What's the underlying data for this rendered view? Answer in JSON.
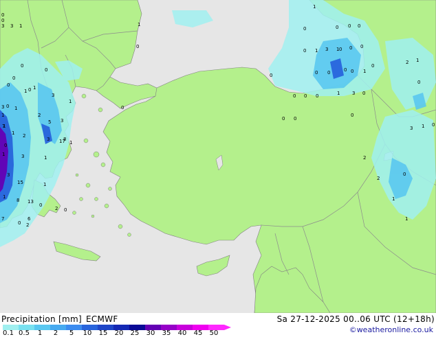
{
  "title": {
    "label": "Precipitation [mm]",
    "model": "ECMWF",
    "datetime": "Sa 27-12-2025 00..06 UTC (12+18h)",
    "credit": "©weatheronline.co.uk"
  },
  "legend": {
    "ticks": [
      "0.1",
      "0.5",
      "1",
      "2",
      "5",
      "10",
      "15",
      "20",
      "25",
      "30",
      "35",
      "40",
      "45",
      "50"
    ],
    "colors": [
      "#a0f0f0",
      "#78e1f0",
      "#5ac8f0",
      "#46aaf0",
      "#3c8cf0",
      "#2864dc",
      "#1e46c8",
      "#1428b4",
      "#0a0a96",
      "#6400b4",
      "#9600c8",
      "#c800dc",
      "#f000f0",
      "#ff28ff"
    ]
  },
  "map_colors": {
    "sea": "#e6e6e6",
    "land": "#b4f08c",
    "border": "#8c8c8c",
    "coast": "#808080"
  },
  "map_values": [
    "1",
    "0",
    "0",
    "0",
    "0",
    "1",
    "3",
    "3",
    "1",
    "0",
    "0",
    "0",
    "1",
    "3",
    "0",
    "1",
    "0",
    "0",
    "0",
    "0",
    "0",
    "0",
    "0",
    "0",
    "0",
    "0",
    "0",
    "0",
    "0",
    "2",
    "1",
    "0",
    "0",
    "0",
    "3",
    "1",
    "0",
    "0",
    "1",
    "3",
    "0",
    "0",
    "1",
    "0",
    "0",
    "1",
    "1",
    "0",
    "0",
    "3",
    "1",
    "0",
    "3",
    "2",
    "7",
    "1",
    "3",
    "1",
    "2",
    "1",
    "8",
    "0",
    "3",
    "2",
    "2",
    "3",
    "17",
    "1",
    "1",
    "5",
    "1",
    "1",
    "3",
    "15",
    "13",
    "0",
    "1",
    "1",
    "8",
    "6",
    "7",
    "2",
    "0",
    "0",
    "2",
    "1",
    "1",
    "0",
    "1"
  ]
}
